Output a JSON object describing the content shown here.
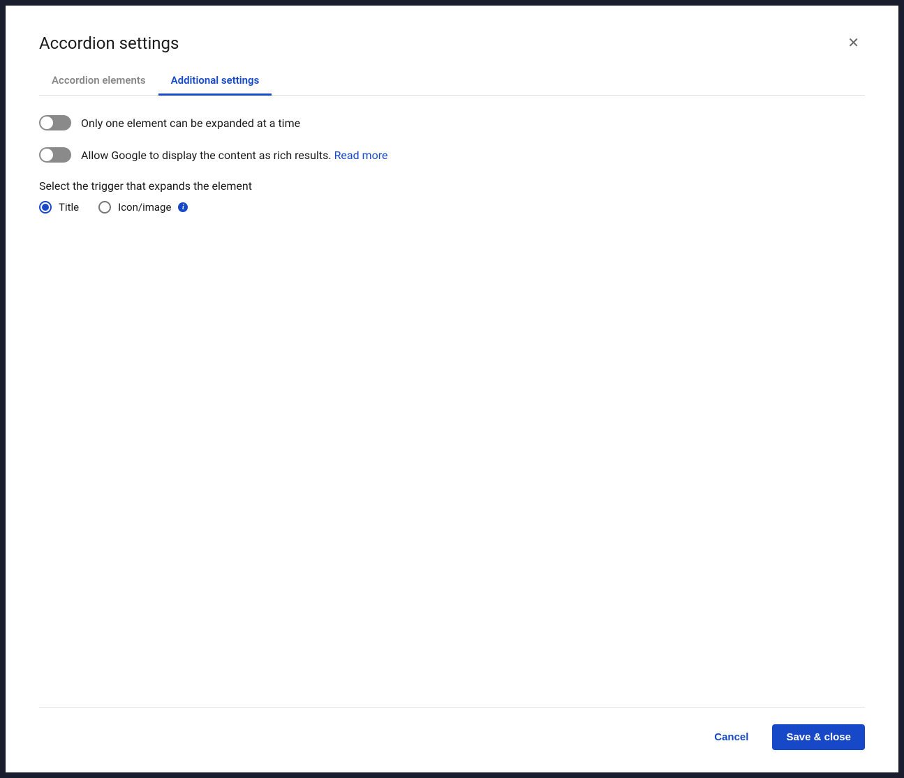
{
  "modal": {
    "title": "Accordion settings"
  },
  "tabs": {
    "elements": "Accordion elements",
    "additional": "Additional settings"
  },
  "settings": {
    "expand_one_label": "Only one element can be expanded at a time",
    "google_rich_label": "Allow Google to display the content as rich results. ",
    "read_more": "Read more",
    "trigger_label": "Select the trigger that expands the element",
    "radio_title": "Title",
    "radio_icon": "Icon/image"
  },
  "footer": {
    "cancel": "Cancel",
    "save": "Save & close"
  }
}
